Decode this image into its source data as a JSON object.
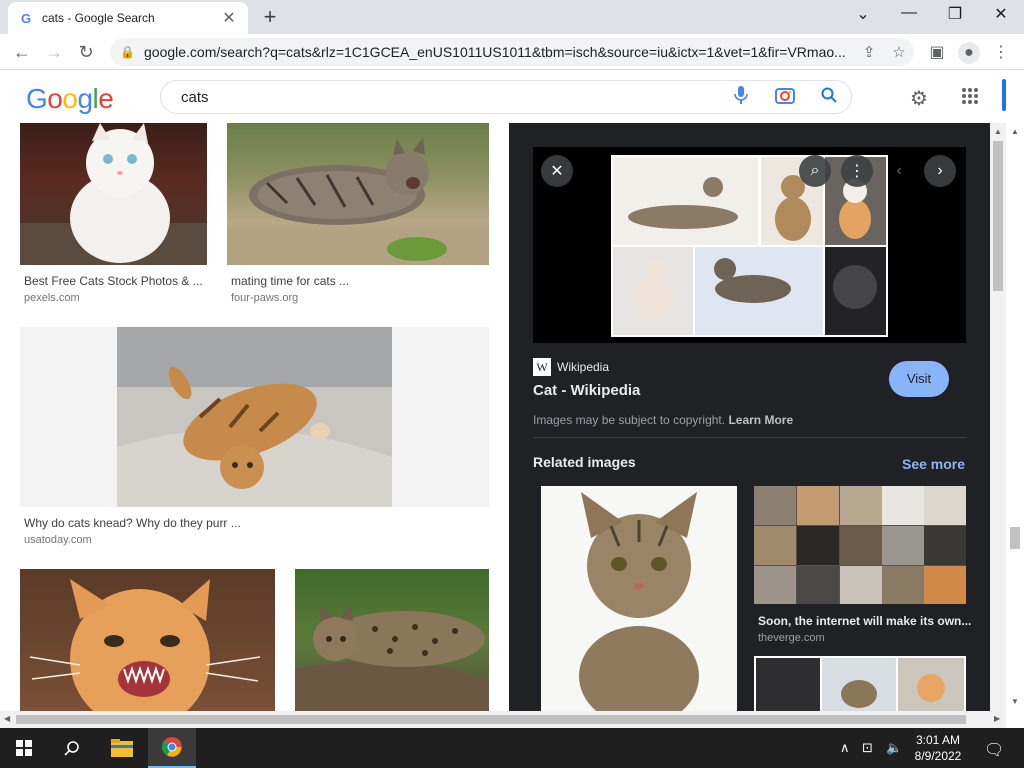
{
  "browser": {
    "tab_title": "cats - Google Search",
    "url": "google.com/search?q=cats&rlz=1C1GCEA_enUS1011US1011&tbm=isch&source=iu&ictx=1&vet=1&fir=VRmao..."
  },
  "search": {
    "query": "cats"
  },
  "results": [
    {
      "caption": "Best Free Cats Stock Photos & ...",
      "source": "pexels.com"
    },
    {
      "caption": "mating time for cats ...",
      "source": "four-paws.org"
    },
    {
      "caption": "Why do cats knead? Why do they purr ...",
      "source": "usatoday.com"
    }
  ],
  "panel": {
    "site": "Wikipedia",
    "title": "Cat - Wikipedia",
    "visit_label": "Visit",
    "copyright_text": "Images may be subject to copyright.",
    "learn_more": "Learn More",
    "related_heading": "Related images",
    "see_more": "See more",
    "related": [
      {
        "caption": "Soon, the internet will make its own...",
        "source": "theverge.com"
      }
    ]
  },
  "taskbar": {
    "time": "3:01 AM",
    "date": "8/9/2022"
  },
  "colors": {
    "accent": "#1a73e8",
    "panel_bg": "#202124",
    "visit_bg": "#8ab4f8"
  }
}
